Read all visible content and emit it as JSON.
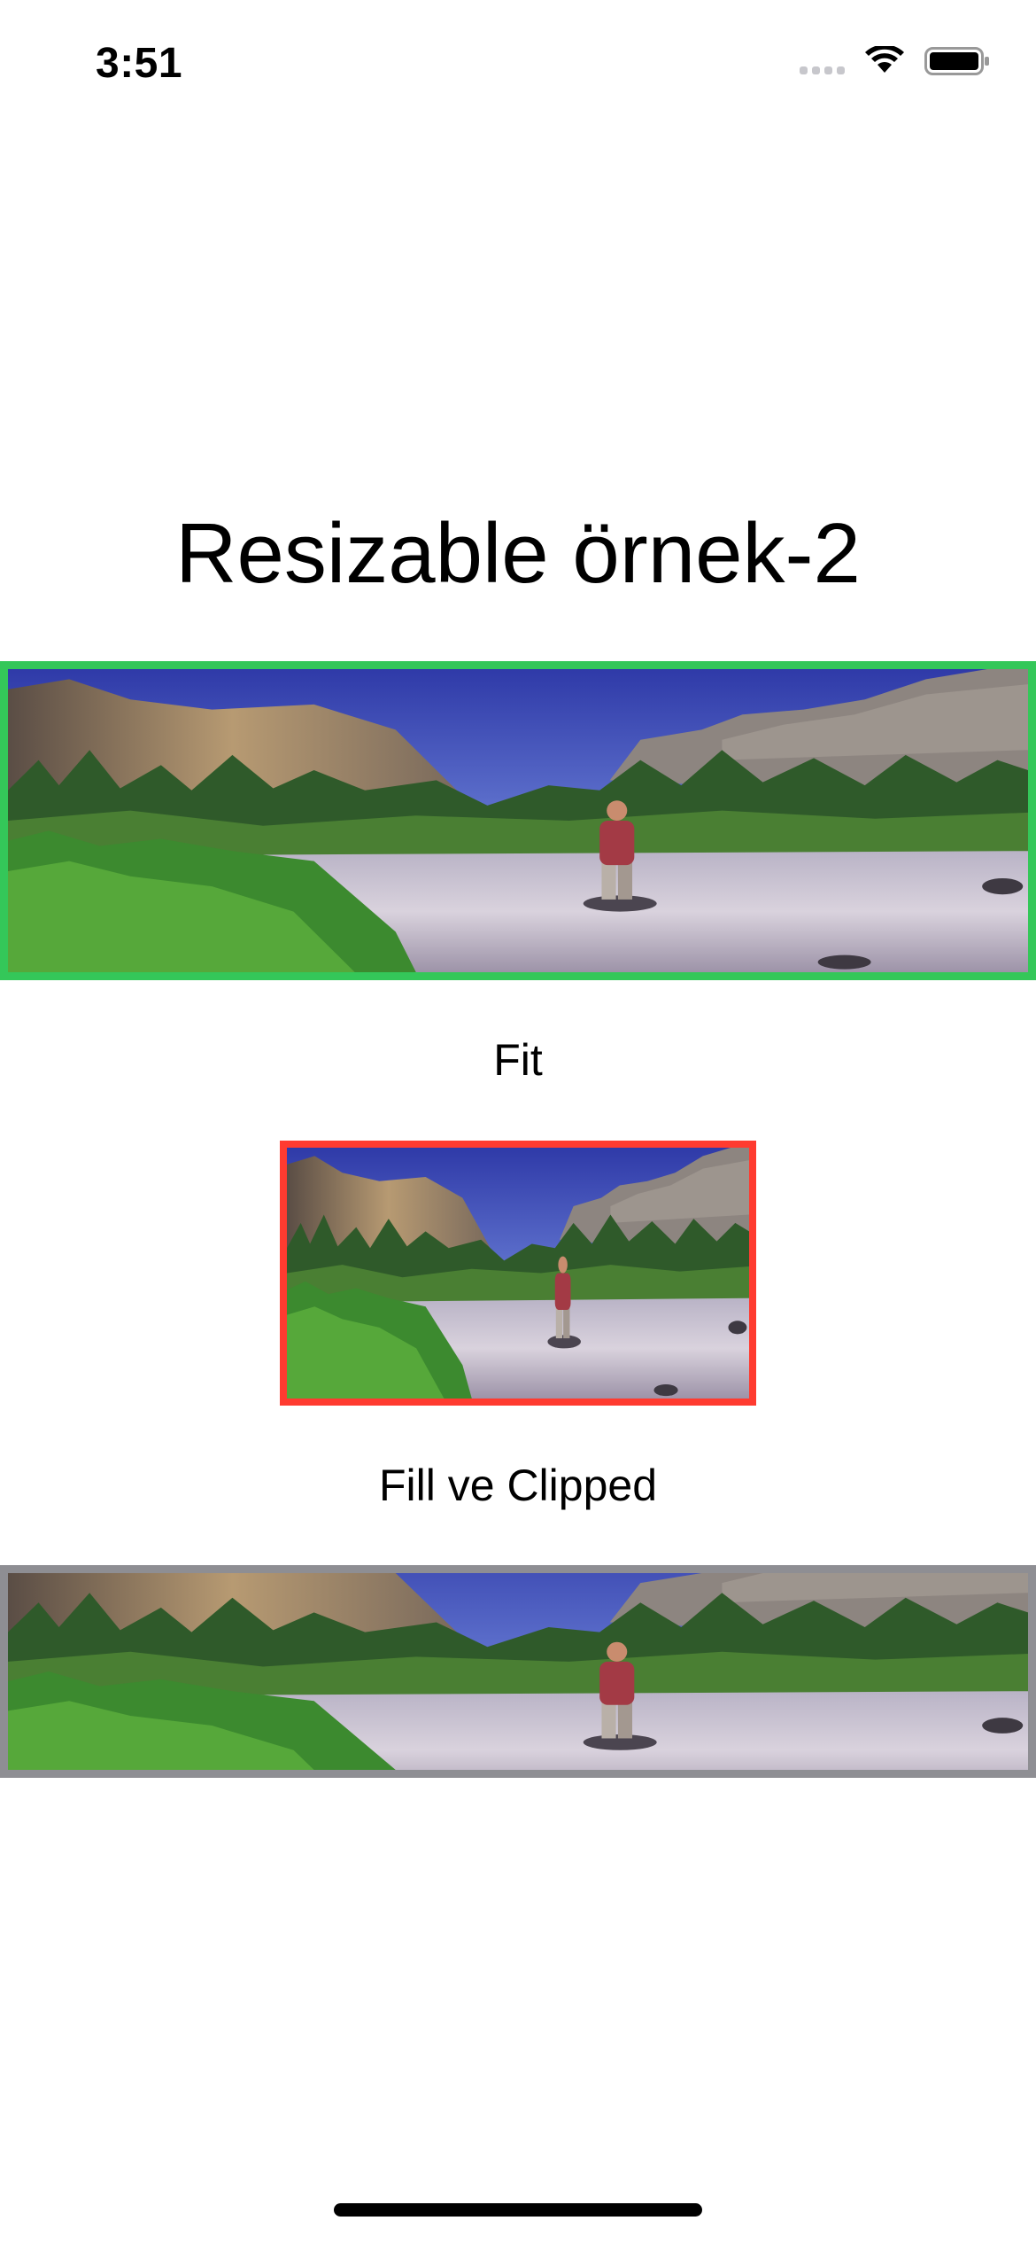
{
  "status_bar": {
    "time": "3:51",
    "icons": [
      "cellular-signal-icon",
      "wifi-icon",
      "battery-icon"
    ]
  },
  "page": {
    "title": "Resizable örnek-2"
  },
  "images": [
    {
      "name": "landscape-image-fit",
      "border_color": "#34c759",
      "caption": "Fit"
    },
    {
      "name": "landscape-image-fill",
      "border_color": "#ff3b30",
      "caption": "Fill ve Clipped"
    },
    {
      "name": "landscape-image-clipped",
      "border_color": "#8e8e93"
    }
  ],
  "colors": {
    "green": "#34c759",
    "red": "#ff3b30",
    "gray": "#8e8e93"
  }
}
